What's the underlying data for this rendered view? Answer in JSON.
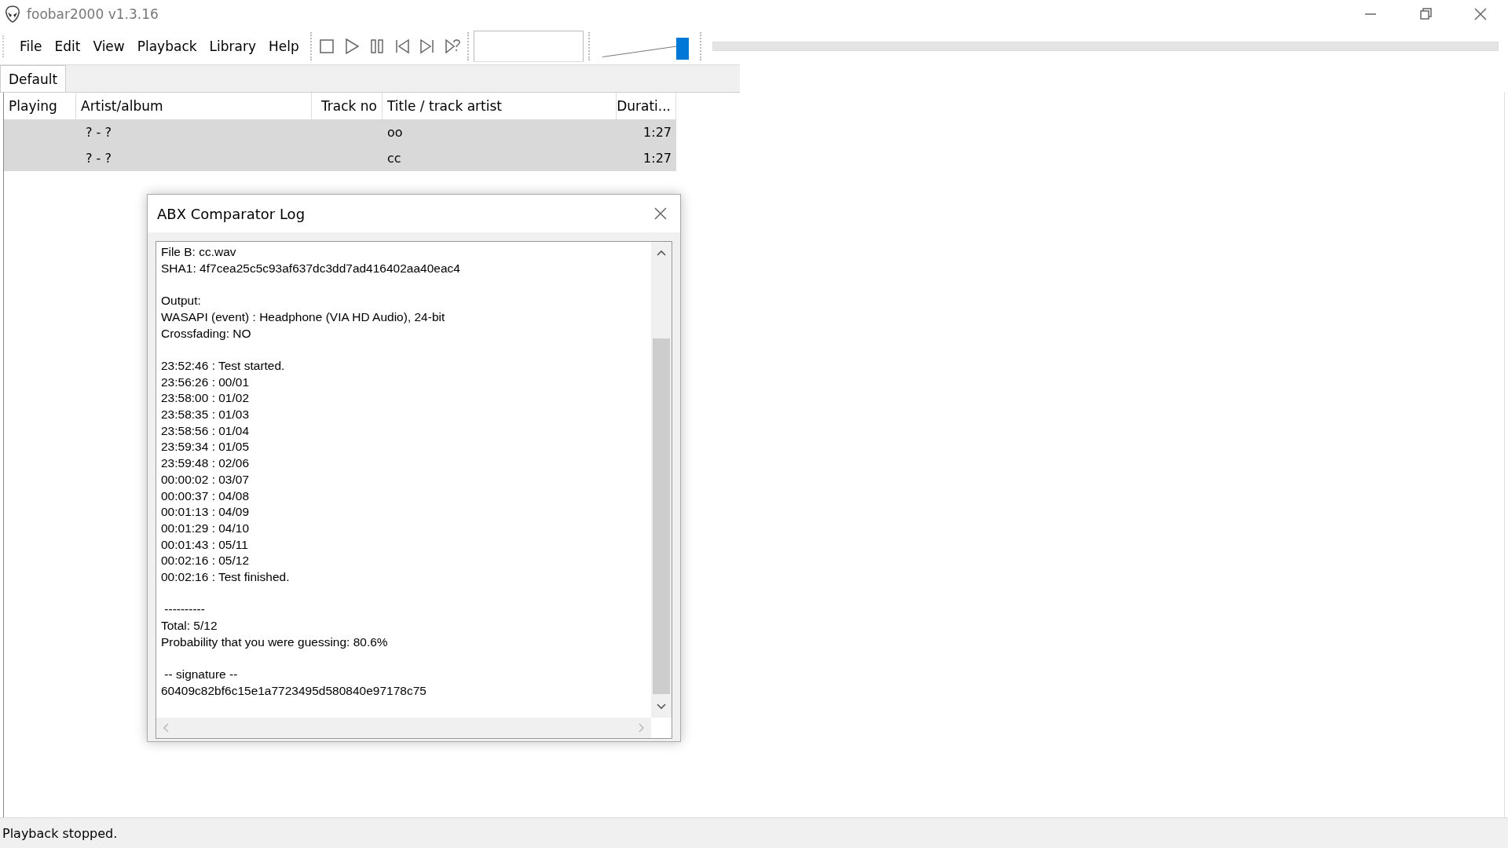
{
  "window": {
    "title": "foobar2000 v1.3.16"
  },
  "menu": [
    "File",
    "Edit",
    "View",
    "Playback",
    "Library",
    "Help"
  ],
  "volume": {
    "level": 0.95
  },
  "tabs": [
    {
      "label": "Default",
      "selected": true
    }
  ],
  "playlist": {
    "columns": [
      "Playing",
      "Artist/album",
      "Track no",
      "Title / track artist",
      "Durati..."
    ],
    "rows": [
      {
        "cells": [
          "",
          "? - ?",
          "",
          "oo",
          "1:27"
        ],
        "selected": true
      },
      {
        "cells": [
          "",
          "? - ?",
          "",
          "cc",
          "1:27"
        ],
        "selected": true
      }
    ]
  },
  "dialog": {
    "title": "ABX Comparator Log",
    "log": [
      [
        "File B: cc.wav",
        "SHA1: 4f7cea25c5c93af637dc3dd7ad416402aa40eac4"
      ],
      [
        "Output:",
        "WASAPI (event) : Headphone (VIA HD Audio), 24-bit",
        "Crossfading: NO"
      ],
      [
        "23:52:46 : Test started.",
        "23:56:26 : 00/01",
        "23:58:00 : 01/02",
        "23:58:35 : 01/03",
        "23:58:56 : 01/04",
        "23:59:34 : 01/05",
        "23:59:48 : 02/06",
        "00:00:02 : 03/07",
        "00:00:37 : 04/08",
        "00:01:13 : 04/09",
        "00:01:29 : 04/10",
        "00:01:43 : 05/11",
        "00:02:16 : 05/12",
        "00:02:16 : Test finished."
      ],
      [
        " ----------",
        "Total: 5/12",
        "Probability that you were guessing: 80.6%"
      ],
      [
        " -- signature --",
        "60409c82bf6c15e1a7723495d580840e97178c75"
      ]
    ]
  },
  "status_bar": "Playback stopped."
}
